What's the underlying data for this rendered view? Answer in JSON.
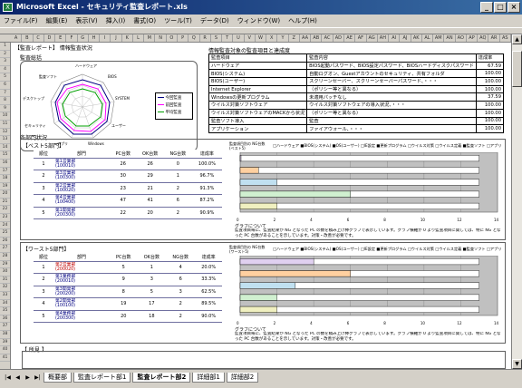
{
  "window": {
    "title": "Microsoft Excel - セキュリティ監査レポート.xls",
    "minimize": "_",
    "maximize": "□",
    "close": "×"
  },
  "menu": [
    "ファイル(F)",
    "編集(E)",
    "表示(V)",
    "挿入(I)",
    "書式(O)",
    "ツール(T)",
    "データ(D)",
    "ウィンドウ(W)",
    "ヘルプ(H)"
  ],
  "columns": [
    "A",
    "B",
    "C",
    "D",
    "E",
    "F",
    "G",
    "H",
    "I",
    "J",
    "K",
    "L",
    "M",
    "N",
    "O",
    "P",
    "Q",
    "R",
    "S",
    "T",
    "U",
    "V",
    "W",
    "X",
    "Y",
    "Z",
    "AA",
    "AB",
    "AC",
    "AD",
    "AE",
    "AF",
    "AG",
    "AH",
    "AI",
    "AJ",
    "AK",
    "AL",
    "AM",
    "AN",
    "AO",
    "AP",
    "AQ",
    "AR",
    "AS",
    "AT"
  ],
  "rows": [
    "1",
    "2",
    "3",
    "4",
    "5",
    "6",
    "7",
    "8",
    "9",
    "10",
    "11",
    "12",
    "13",
    "14",
    "15",
    "16",
    "17",
    "18",
    "19",
    "20",
    "21",
    "22",
    "23",
    "24",
    "25",
    "26",
    "27",
    "28",
    "29",
    "30",
    "31",
    "32",
    "33",
    "34",
    "35",
    "36",
    "37",
    "38",
    "39",
    "40",
    "41"
  ],
  "report": {
    "heading": "【監査レポート】 情報監査状況",
    "overall_label": "監査総括",
    "radar": {
      "axes": [
        "ハードウェア",
        "BIOS",
        "SYSTEM",
        "ユーザー",
        "Windows",
        "アプリ",
        "セキュリティ",
        "デスクトップ",
        "監査ソフト"
      ],
      "legend": [
        "今回監査",
        "前回監査",
        "平均監査"
      ],
      "colors": [
        "#000080",
        "#ff00ff",
        "#00a000"
      ]
    },
    "item_table_label": "情報監査対象の監査項目と達成度",
    "item_headers": [
      "監査項目",
      "監査内容",
      "達成率"
    ],
    "items": [
      {
        "name": "ハードウェア",
        "desc": "BIOS起動パスワード、BIOS設定パスワード、BIOSハードディスクパスワード",
        "rate": "67.59"
      },
      {
        "name": "BIOS(システム)",
        "desc": "自動ログオン、Guestアカウントのセキュリティ、共有フォルダ",
        "rate": "100.00"
      },
      {
        "name": "BIOS(ユーザー)",
        "desc": "スクリーンセーバー、スクリーンセーバーパスワード、・・・",
        "rate": "100.00"
      },
      {
        "name": "Internet Explorer",
        "desc": "（ポリシー等と異なる）",
        "rate": "100.00"
      },
      {
        "name": "Windowsの更新プログラム",
        "desc": "未適用パッチなし",
        "rate": "37.59"
      },
      {
        "name": "ウイルス対策ソフトウェア",
        "desc": "ウイルス対策ソフトウェアの導入状況、・・・",
        "rate": "100.00"
      },
      {
        "name": "ウイルス対策ソフトウェアのMACKから状況",
        "desc": "（ポリシー等と異なる）",
        "rate": "100.00"
      },
      {
        "name": "監査ソフト導入",
        "desc": "監査",
        "rate": "100.00"
      },
      {
        "name": "アプリケーション",
        "desc": "ファイアウォール、・・・",
        "rate": "100.00"
      }
    ],
    "dept_label": "各部門状況",
    "sections": [
      {
        "title": "【ベスト5部門】",
        "headers": [
          "順位",
          "部門",
          "PC台数",
          "OK台数",
          "NG台数",
          "達成率"
        ],
        "rows": [
          {
            "rank": "1",
            "dept": "第1営業部",
            "code": "(100010)",
            "pc": "26",
            "ok": "26",
            "ng": "0",
            "rate": "100.0%",
            "red": false
          },
          {
            "rank": "2",
            "dept": "第3営業部",
            "code": "(100300)",
            "pc": "30",
            "ok": "29",
            "ng": "1",
            "rate": "96.7%",
            "red": false
          },
          {
            "rank": "3",
            "dept": "第2営業部",
            "code": "(100020)",
            "pc": "23",
            "ok": "21",
            "ng": "2",
            "rate": "91.3%",
            "red": false
          },
          {
            "rank": "4",
            "dept": "第4営業部",
            "code": "(100400)",
            "pc": "47",
            "ok": "41",
            "ng": "6",
            "rate": "87.2%",
            "red": false
          },
          {
            "rank": "5",
            "dept": "第1開発部",
            "code": "(200300)",
            "pc": "22",
            "ok": "20",
            "ng": "2",
            "rate": "90.9%",
            "red": false
          }
        ],
        "chart_title": "監査項目別の NG台数\n(ベスト5)",
        "legend": "□ハードウェア ■BIOS(システム) ■OS(ユーザー) □IE設定 ■更新プログラム □ウイルス対策 □ウイルス定義 ■監査ソフト □アプリ",
        "axis": [
          "0",
          "2",
          "4",
          "6",
          "8",
          "10",
          "12",
          "14"
        ],
        "note_title": "グラフについて",
        "note": "監査項目毎に、監査結果が NG となった PC の数を積み上げ棒グラフで表示しています。グラフ横軸が 0 より監査項目に関しては、特に NG となった PC 台数があることを示しています。対策・改善が必要です。"
      },
      {
        "title": "【ワースト5部門】",
        "headers": [
          "順位",
          "部門",
          "PC台数",
          "OK台数",
          "NG台数",
          "達成率"
        ],
        "rows": [
          {
            "rank": "1",
            "dept": "第2営業部",
            "code": "(200020)",
            "pc": "5",
            "ok": "1",
            "ng": "4",
            "rate": "20.0%",
            "red": true
          },
          {
            "rank": "2",
            "dept": "第1業務部",
            "code": "(200010)",
            "pc": "9",
            "ok": "3",
            "ng": "6",
            "rate": "33.3%",
            "red": false
          },
          {
            "rank": "3",
            "dept": "第3開発部",
            "code": "(200200)",
            "pc": "8",
            "ok": "5",
            "ng": "3",
            "rate": "62.5%",
            "red": false
          },
          {
            "rank": "4",
            "dept": "第2開発部",
            "code": "(100100)",
            "pc": "19",
            "ok": "17",
            "ng": "2",
            "rate": "89.5%",
            "red": false
          },
          {
            "rank": "5",
            "dept": "第4業務部",
            "code": "(200300)",
            "pc": "20",
            "ok": "18",
            "ng": "2",
            "rate": "90.0%",
            "red": false
          }
        ],
        "chart_title": "監査項目別の NG台数\n(ワースト5)",
        "legend": "□ハードウェア ■BIOS(システム) ■OS(ユーザー) □IE設定 ■更新プログラム □ウイルス対策 □ウイルス定義 ■監査ソフト □アプリ",
        "axis": [
          "0",
          "2",
          "4",
          "6",
          "8",
          "10",
          "12",
          "14"
        ],
        "note_title": "グラフについて",
        "note": "監査項目毎に、監査結果が NG となった PC の数を積み上げ棒グラフで表示しています。グラフ横軸が 0 より監査項目に関しては、特に NG となった PC 台数があることを示しています。対策・改善が必要です。"
      }
    ],
    "remarks_label": "【 所見 】"
  },
  "sheet_tabs": [
    "概要部",
    "監査レポート部1",
    "監査レポート部2",
    "詳細部1",
    "詳細部2"
  ],
  "active_tab": 2,
  "tab_nav": [
    "|◀",
    "◀",
    "▶",
    "▶|"
  ],
  "scroll": {
    "up": "▲",
    "down": "▼"
  },
  "chart_data": [
    {
      "type": "bar",
      "title": "",
      "categories": [
        "第1営業部",
        "第3営業部",
        "第2営業部",
        "第4営業部",
        "第1開発部"
      ],
      "series": [
        {
          "values": [
            0,
            1,
            2,
            6,
            2
          ]
        }
      ],
      "xlim": [
        0,
        14
      ]
    },
    {
      "type": "bar",
      "title": "",
      "categories": [
        "第2営業部",
        "第1業務部",
        "第3開発部",
        "第2開発部",
        "第4業務部"
      ],
      "series": [
        {
          "values": [
            4,
            6,
            3,
            2,
            2
          ]
        }
      ],
      "xlim": [
        0,
        14
      ]
    }
  ]
}
